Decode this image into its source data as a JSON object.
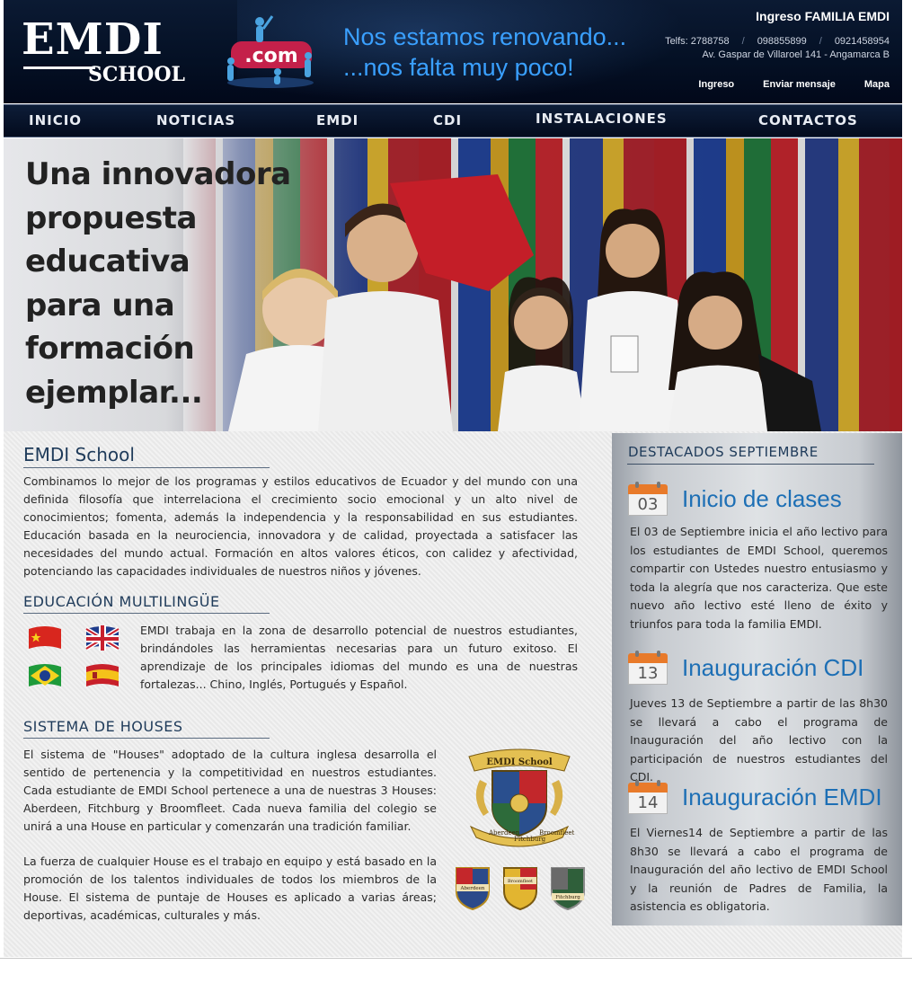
{
  "header": {
    "logo_main": "EMDI",
    "logo_sub": "SCHOOL",
    "com_badge": ".com",
    "slogan_line1": "Nos estamos renovando...",
    "slogan_line2": "...nos falta muy poco!",
    "login_label": "Ingreso FAMILIA EMDI",
    "phones": [
      "Telfs: 2788758",
      "098855899",
      "0921458954"
    ],
    "address": "Av. Gaspar de Villaroel 141 - Angamarca B",
    "links": [
      "Ingreso",
      "Enviar mensaje",
      "Mapa"
    ]
  },
  "nav": {
    "items": [
      "INICIO",
      "NOTICIAS",
      "EMDI",
      "CDI",
      "INSTALACIONES",
      "CONTACTOS"
    ]
  },
  "banner": {
    "lines": [
      "Una innovadora",
      "propuesta",
      "educativa",
      "para una",
      "formación",
      "ejemplar..."
    ]
  },
  "main": {
    "s1_title": "EMDI School",
    "s1_text": "Combinamos lo mejor de los programas y estilos educativos de Ecuador y del mundo con una definida filosofía que interrelaciona el crecimiento socio emocional y un alto nivel de conocimientos; fomenta, además la independencia y la responsabilidad en sus estudiantes. Educación basada en la neurociencia, innovadora y de calidad, proyectada a satisfacer las necesidades del mundo actual. Formación en altos valores éticos, con calidez y afectividad, potenciando las capacidades individuales de nuestros niños y jóvenes.",
    "s2_title": "EDUCACIÓN MULTILINGÜE",
    "s2_text": "EMDI trabaja en la zona de desarrollo potencial de nuestros estudiantes, brindándoles las herramientas necesarias para un futuro exitoso. El aprendizaje de los principales idiomas del mundo es una de nuestras fortalezas... Chino, Inglés, Portugués y Español.",
    "s3_title": "SISTEMA DE HOUSES",
    "s3_text1": "El sistema de \"Houses\" adoptado de la cultura inglesa desarrolla el sentido de pertenencia y la competitividad en nuestros estudiantes. Cada estudiante de EMDI School pertenece a una de nuestras 3 Houses: Aberdeen, Fitchburg y Broomfleet. Cada nueva familia del colegio se unirá a una House en particular y comenzarán una tradición familiar.",
    "s3_text2": "La fuerza de cualquier House es el trabajo en equipo y está basado en la promoción de los talentos individuales de todos los miembros de la House. El sistema de puntaje de Houses es aplicado a varias áreas; deportivas, académicas, culturales y más.",
    "crest_title": "EMDI School",
    "crest_houses": [
      "Aberdeen",
      "Fitchburg",
      "Broomfleet"
    ],
    "shield_labels": [
      "Aberdeen",
      "Broomfleet",
      "Fitchburg"
    ]
  },
  "sidebar": {
    "title": "DESTACADOS SEPTIEMBRE",
    "events": [
      {
        "day": "03",
        "title": "Inicio de clases",
        "text": "El 03 de Septiembre inicia el año lectivo para los estudiantes de EMDI School, queremos compartir con Ustedes nuestro entusiasmo y toda la alegría que nos caracteriza. Que este nuevo año lectivo esté lleno de éxito y triunfos para toda la familia EMDI."
      },
      {
        "day": "13",
        "title": "Inauguración CDI",
        "text": "Jueves 13 de Septiembre a partir de las 8h30 se llevará a cabo el programa de Inauguración del año lectivo con la participación de nuestros estudiantes del CDI."
      },
      {
        "day": "14",
        "title": "Inauguración EMDI",
        "text": "El Viernes14 de Septiembre a partir de las 8h30 se llevará a cabo el programa de Inauguración del año lectivo de EMDI School y la reunión de Padres de Familia, la asistencia es obligatoria."
      }
    ]
  },
  "colors": {
    "header_bg": "#041024",
    "slogan": "#3aa0ff",
    "heading": "#1f3b5a",
    "event_title": "#1d6fb5",
    "calendar": "#e87a2a"
  }
}
